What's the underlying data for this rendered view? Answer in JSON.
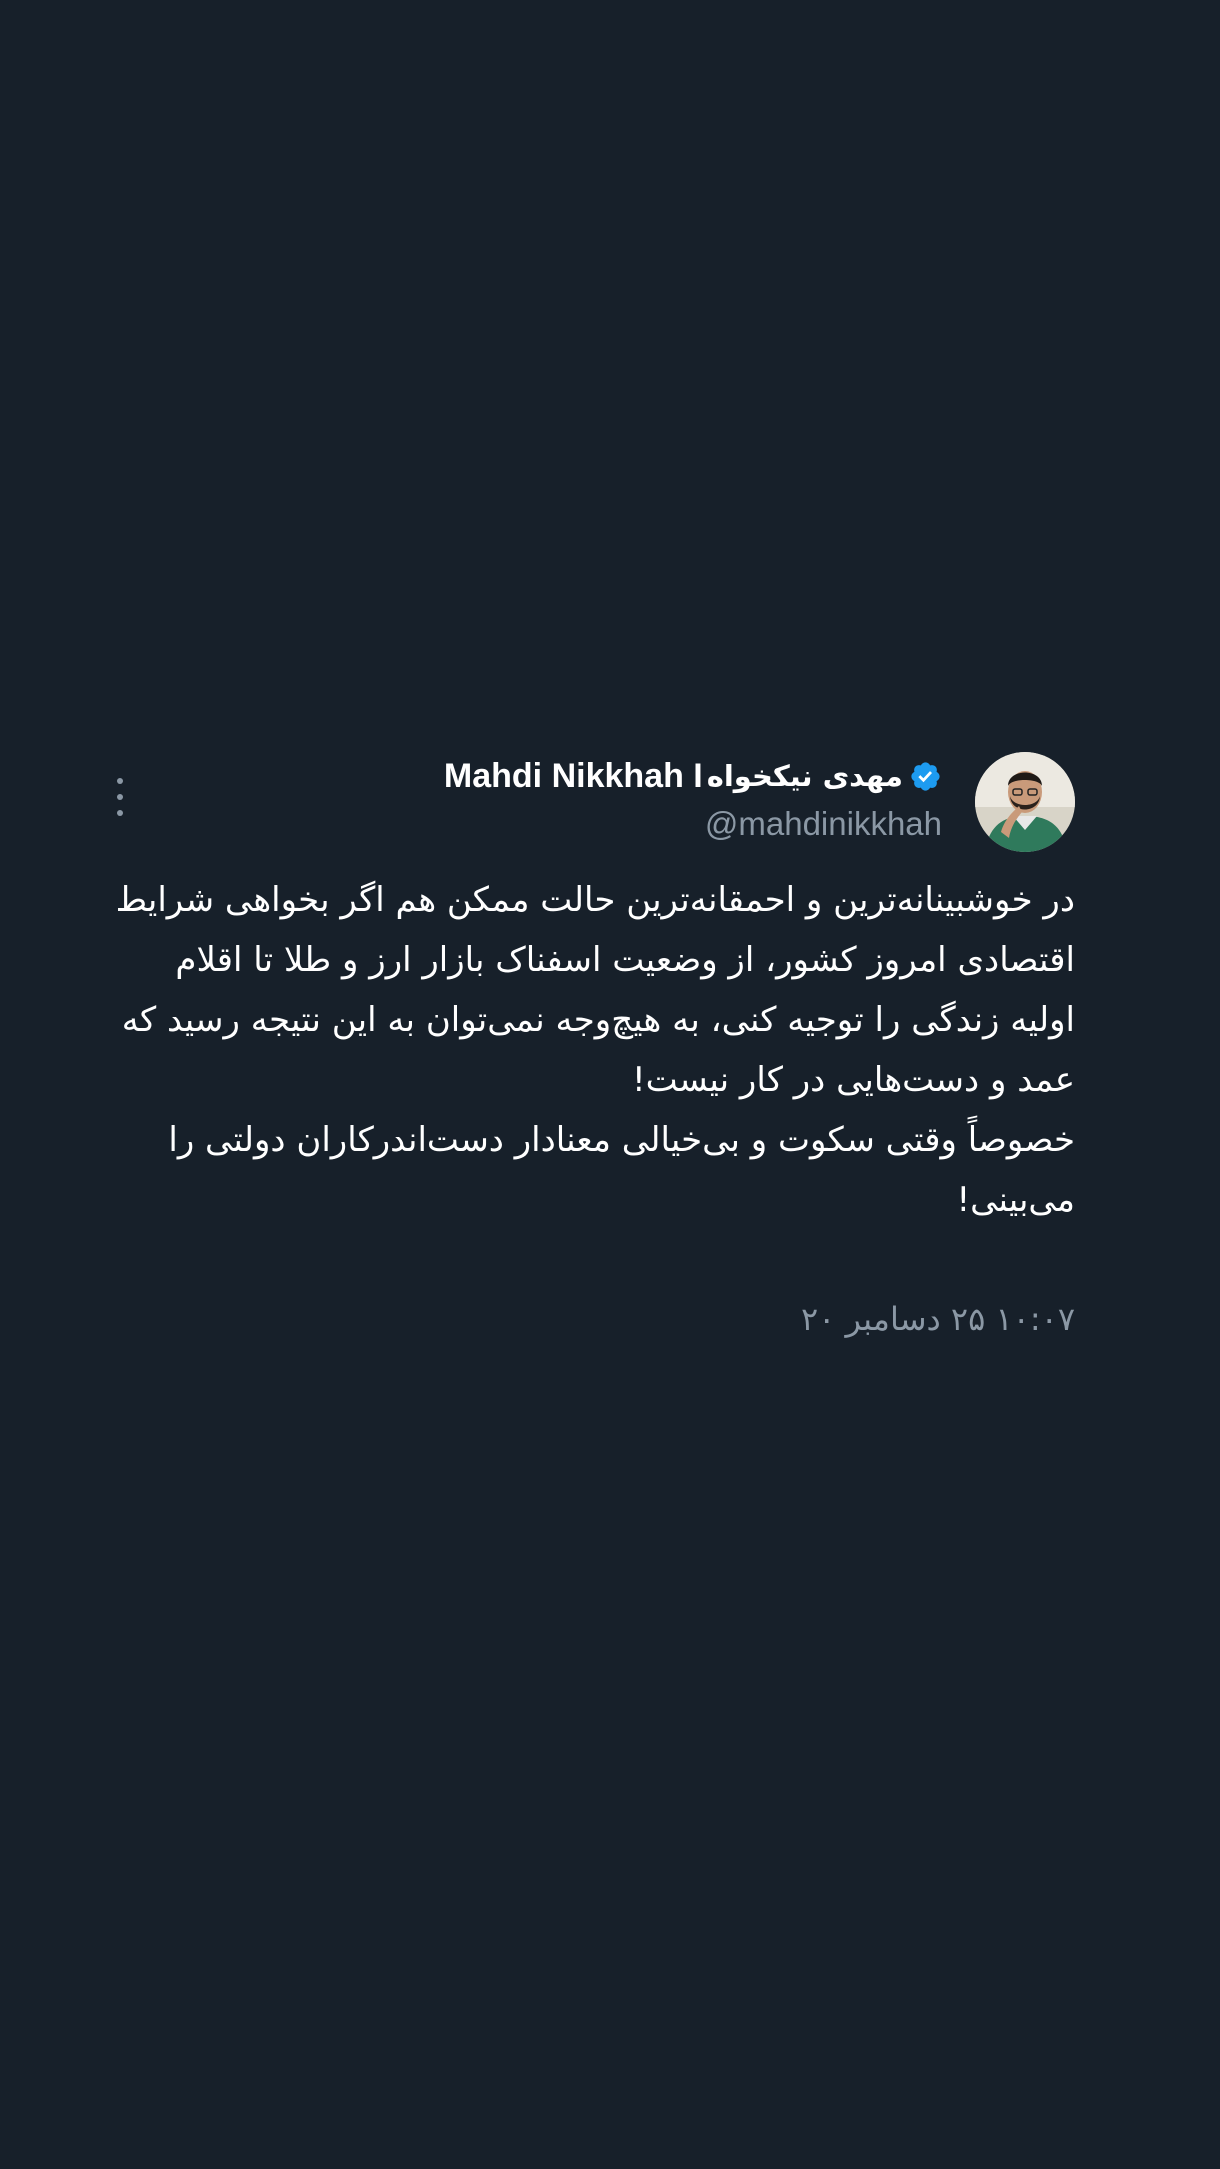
{
  "tweet": {
    "author": {
      "name_persian": "مهدی نیکخواه",
      "name_latin": "Mahdi Nikkhah I",
      "handle": "@mahdinikkhah",
      "verified_color": "#1d9bf0"
    },
    "body_paragraphs": [
      "در خوشبینانه‌ترین و احمقانه‌ترین حالت ممکن هم اگر بخواهی شرایط اقتصادی امروز کشور، از وضعیت اسفناک بازار ارز و طلا تا اقلام اولیه زندگی را توجیه کنی، به هیچ‌وجه نمی‌توان به این نتیجه رسید که عمد و دست‌هایی در کار نیست!",
      "خصوصاً وقتی سکوت و بی‌خیالی معنادار دست‌اندرکاران دولتی را می‌بینی!"
    ],
    "timestamp": "۱۰:۰۷ ۲۵ دسامبر ۲۰"
  },
  "icons": {
    "more": "more-vertical-icon",
    "verified": "verified-badge-icon"
  },
  "colors": {
    "background": "#17202a",
    "text_primary": "#ffffff",
    "text_secondary": "#8b98a5"
  }
}
